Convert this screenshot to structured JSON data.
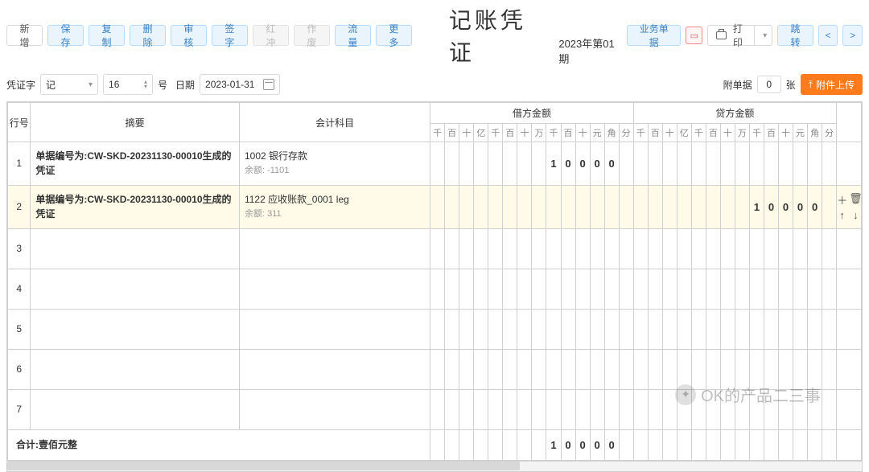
{
  "toolbar": {
    "new": "新增",
    "save": "保存",
    "copy": "复制",
    "delete": "删除",
    "audit": "审核",
    "sign": "签字",
    "reverse": "红冲",
    "void": "作废",
    "flow": "流量",
    "more": "更多",
    "biz_doc": "业务单据",
    "print": "打印",
    "jump": "跳转"
  },
  "title": "记账凭证",
  "period": "2023年第01期",
  "row2": {
    "voucher_word_label": "凭证字",
    "voucher_word_value": "记",
    "voucher_no": "16",
    "no_label": "号",
    "date_label": "日期",
    "date_value": "2023-01-31",
    "attach_label": "附单据",
    "attach_count": "0",
    "attach_unit": "张",
    "upload": "附件上传"
  },
  "columns": {
    "rownum": "行号",
    "summary": "摘要",
    "subject": "会计科目",
    "debit": "借方金额",
    "credit": "贷方金额"
  },
  "digit_heads": [
    "千",
    "百",
    "十",
    "亿",
    "千",
    "百",
    "十",
    "万",
    "千",
    "百",
    "十",
    "元",
    "角",
    "分"
  ],
  "rows": [
    {
      "num": "1",
      "summary": "单据编号为:CW-SKD-20231130-00010生成的凭证",
      "subject": "1002  银行存款",
      "balance_label": "余额:",
      "balance": "-1101",
      "debit": [
        "",
        "",
        "",
        "",
        "",
        "",
        "",
        "",
        "1",
        "0",
        "0",
        "0",
        "0",
        ""
      ],
      "credit": [
        "",
        "",
        "",
        "",
        "",
        "",
        "",
        "",
        "",
        "",
        "",
        "",
        "",
        ""
      ],
      "selected": false
    },
    {
      "num": "2",
      "summary": "单据编号为:CW-SKD-20231130-00010生成的凭证",
      "subject": "1122  应收账款_0001 leg",
      "balance_label": "余额:",
      "balance": "311",
      "debit": [
        "",
        "",
        "",
        "",
        "",
        "",
        "",
        "",
        "",
        "",
        "",
        "",
        "",
        ""
      ],
      "credit": [
        "",
        "",
        "",
        "",
        "",
        "",
        "",
        "",
        "1",
        "0",
        "0",
        "0",
        "0",
        ""
      ],
      "selected": true
    },
    {
      "num": "3",
      "summary": "",
      "subject": "",
      "balance_label": "",
      "balance": "",
      "debit": [
        "",
        "",
        "",
        "",
        "",
        "",
        "",
        "",
        "",
        "",
        "",
        "",
        "",
        ""
      ],
      "credit": [
        "",
        "",
        "",
        "",
        "",
        "",
        "",
        "",
        "",
        "",
        "",
        "",
        "",
        ""
      ],
      "selected": false
    },
    {
      "num": "4",
      "summary": "",
      "subject": "",
      "balance_label": "",
      "balance": "",
      "debit": [
        "",
        "",
        "",
        "",
        "",
        "",
        "",
        "",
        "",
        "",
        "",
        "",
        "",
        ""
      ],
      "credit": [
        "",
        "",
        "",
        "",
        "",
        "",
        "",
        "",
        "",
        "",
        "",
        "",
        "",
        ""
      ],
      "selected": false
    },
    {
      "num": "5",
      "summary": "",
      "subject": "",
      "balance_label": "",
      "balance": "",
      "debit": [
        "",
        "",
        "",
        "",
        "",
        "",
        "",
        "",
        "",
        "",
        "",
        "",
        "",
        ""
      ],
      "credit": [
        "",
        "",
        "",
        "",
        "",
        "",
        "",
        "",
        "",
        "",
        "",
        "",
        "",
        ""
      ],
      "selected": false
    },
    {
      "num": "6",
      "summary": "",
      "subject": "",
      "balance_label": "",
      "balance": "",
      "debit": [
        "",
        "",
        "",
        "",
        "",
        "",
        "",
        "",
        "",
        "",
        "",
        "",
        "",
        ""
      ],
      "credit": [
        "",
        "",
        "",
        "",
        "",
        "",
        "",
        "",
        "",
        "",
        "",
        "",
        "",
        ""
      ],
      "selected": false
    },
    {
      "num": "7",
      "summary": "",
      "subject": "",
      "balance_label": "",
      "balance": "",
      "debit": [
        "",
        "",
        "",
        "",
        "",
        "",
        "",
        "",
        "",
        "",
        "",
        "",
        "",
        ""
      ],
      "credit": [
        "",
        "",
        "",
        "",
        "",
        "",
        "",
        "",
        "",
        "",
        "",
        "",
        "",
        ""
      ],
      "selected": false
    }
  ],
  "total": {
    "label": "合计:壹佰元整",
    "debit": [
      "",
      "",
      "",
      "",
      "",
      "",
      "",
      "",
      "1",
      "0",
      "0",
      "0",
      "0",
      ""
    ],
    "credit": [
      "",
      "",
      "",
      "",
      "",
      "",
      "",
      "",
      "",
      "",
      "",
      "",
      "",
      ""
    ]
  },
  "watermark": "OK的产品二三事"
}
